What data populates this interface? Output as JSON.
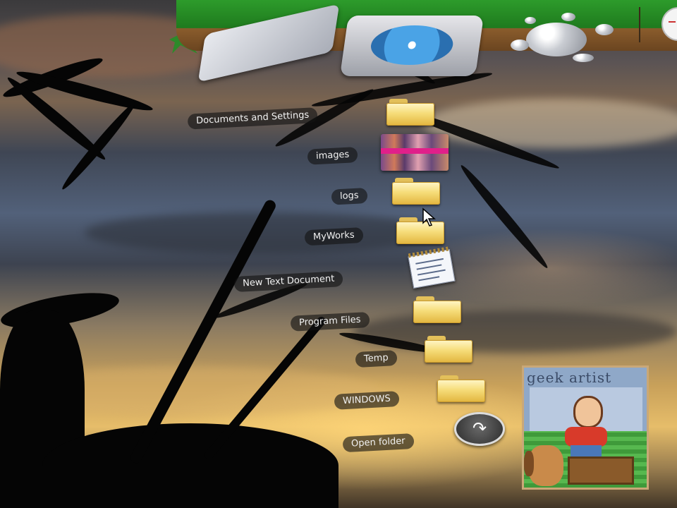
{
  "desktop": {
    "dock": {
      "items": [
        {
          "name": "flat-drive",
          "icon": "external-drive-icon"
        },
        {
          "name": "disk-drive",
          "icon": "hard-disk-icon"
        },
        {
          "name": "bubbles",
          "icon": "bubbles-icon"
        },
        {
          "name": "clock",
          "icon": "clock-icon"
        }
      ]
    },
    "stack": {
      "items": [
        {
          "label": "Documents and Settings",
          "icon": "folder-icon"
        },
        {
          "label": "images",
          "icon": "image-thumbnail-icon"
        },
        {
          "label": "logs",
          "icon": "folder-icon"
        },
        {
          "label": "MyWorks",
          "icon": "folder-icon"
        },
        {
          "label": "New Text Document",
          "icon": "text-document-icon"
        },
        {
          "label": "Program Files",
          "icon": "folder-icon"
        },
        {
          "label": "Temp",
          "icon": "folder-icon"
        },
        {
          "label": "WINDOWS",
          "icon": "folder-icon"
        }
      ],
      "open_folder_label": "Open folder",
      "open_folder_icon": "open-arrow-icon"
    },
    "widget": {
      "title": "geek artist"
    },
    "colors": {
      "dock_green": "#2d9b2b",
      "folder_yellow": "#f6dd7a",
      "label_bg": "#202020"
    }
  }
}
